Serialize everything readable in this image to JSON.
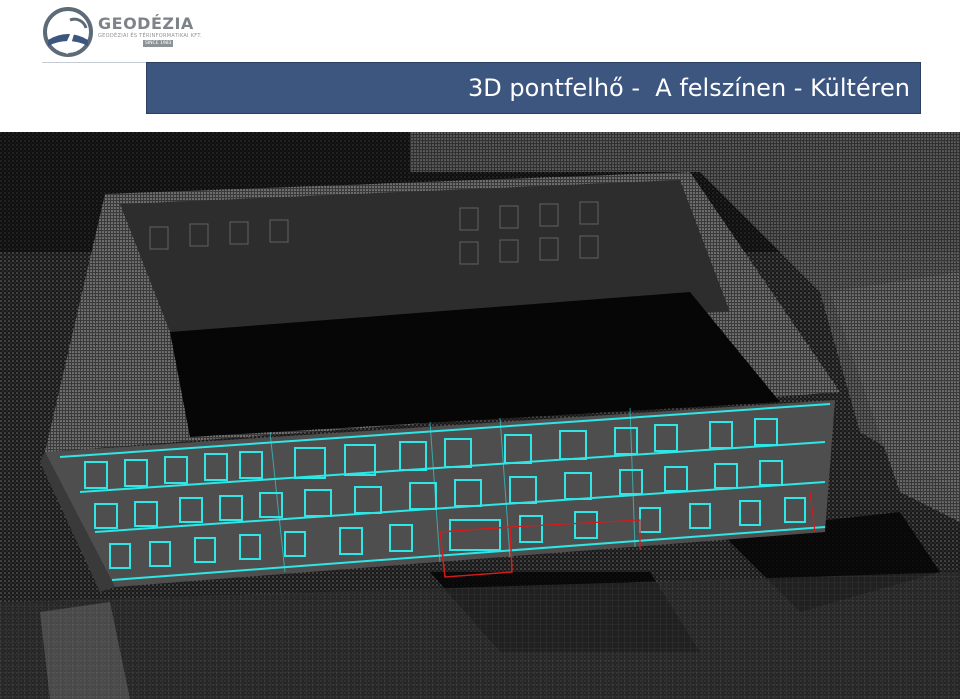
{
  "logo": {
    "name": "GEODÉZIA",
    "tagline": "GEODÉZIAI ÉS TÉRINFORMATIKAI KFT.",
    "since": "SINCE 1983"
  },
  "slide": {
    "title": "3D pontfelhő -  A felszínen - Kültéren"
  },
  "colors": {
    "title_bar": "#3c5680",
    "highlight_cyan": "#2ee6e6",
    "highlight_red": "#d21c1c"
  }
}
